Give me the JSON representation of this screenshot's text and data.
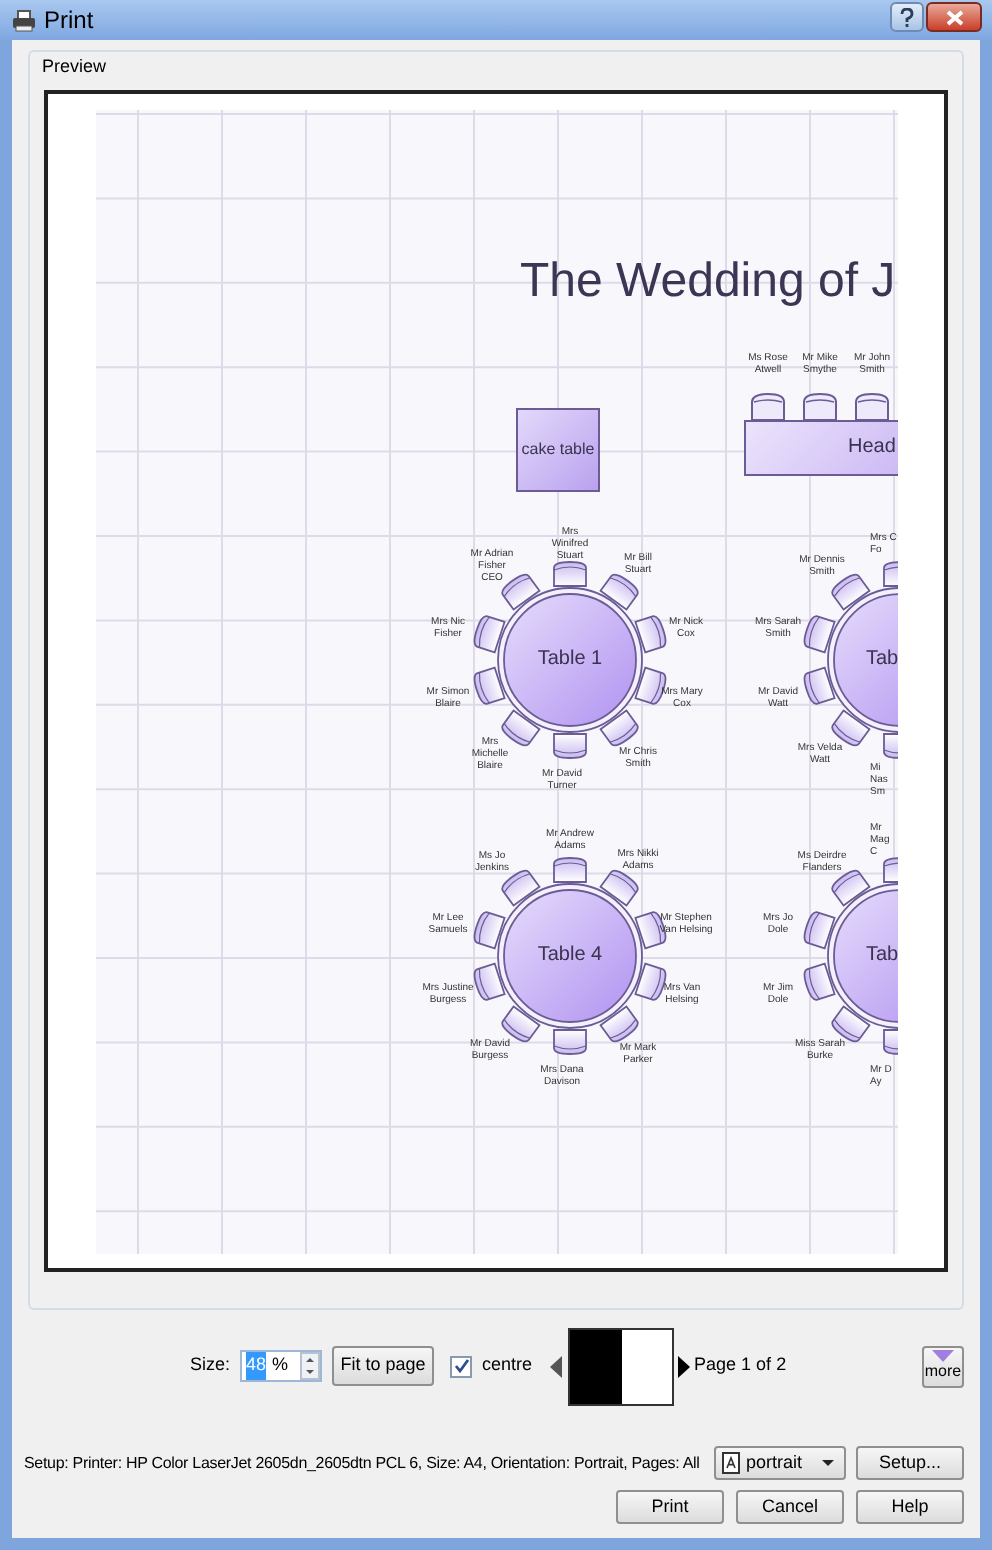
{
  "window": {
    "title": "Print"
  },
  "preview": {
    "label": "Preview",
    "page": {
      "title": "The Wedding of J",
      "cake_table": {
        "label": "cake table"
      },
      "head_table": {
        "label": "Head",
        "guests": [
          "Ms Rose\nAtwell",
          "Mr Mike\nSmythe",
          "Mr John\nSmith"
        ]
      },
      "tables": [
        {
          "label": "Table 1",
          "guests": [
            "Mrs\nWinifred\nStuart",
            "Mr Adrian\nFisher\nCEO",
            "Mr Bill\nStuart",
            "Mrs Nic\nFisher",
            "Mr Nick\nCox",
            "Mr Simon\nBlaire",
            "Mrs Mary\nCox",
            "Mrs\nMichelle\nBlaire",
            "Mr Chris\nSmith",
            "Mr David\nTurner"
          ]
        },
        {
          "label": "Tab",
          "guests": [
            "Mrs C\nFo",
            "Mr Dennis\nSmith",
            "Mrs Sarah\nSmith",
            "Mr David\nWatt",
            "Mrs Velda\nWatt",
            "Mi\nNas\nSm"
          ]
        },
        {
          "label": "Table 4",
          "guests": [
            "Mr Andrew\nAdams",
            "Ms Jo\nJenkins",
            "Mrs Nikki\nAdams",
            "Mr Lee\nSamuels",
            "Mr Stephen\nVan Helsing",
            "Mrs Justine\nBurgess",
            "Mrs Van\nHelsing",
            "Mr David\nBurgess",
            "Mr Mark\nParker",
            "Mrs Dana\nDavison"
          ]
        },
        {
          "label": "Tab",
          "guests": [
            "Mr\nMag\nC",
            "Ms Deirdre\nFlanders",
            "Mrs Jo\nDole",
            "Mr Jim\nDole",
            "Miss Sarah\nBurke",
            "Mr D\nAy"
          ]
        }
      ]
    }
  },
  "size": {
    "label": "Size:",
    "value": "48",
    "unit": "%",
    "selected": true
  },
  "fit_button": "Fit to page",
  "centre": {
    "label": "centre",
    "checked": true
  },
  "page_indicator": "Page 1 of 2",
  "more_button": "more",
  "setup_summary": "Setup:  Printer: HP Color LaserJet 2605dn_2605dtn PCL 6, Size:  A4, Orientation: Portrait, Pages: All",
  "orientation": {
    "value": "portrait"
  },
  "setup_button": "Setup...",
  "buttons": [
    "Print",
    "Cancel",
    "Help"
  ]
}
